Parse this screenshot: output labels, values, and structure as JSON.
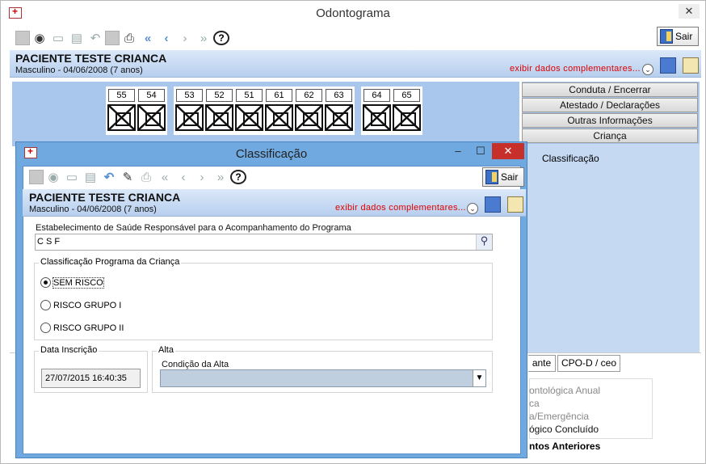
{
  "main_window": {
    "title": "Odontograma",
    "close_glyph": "✕"
  },
  "toolbar": {
    "sair_label": "Sair"
  },
  "patient": {
    "name": "PACIENTE TESTE CRIANCA",
    "info": "Masculino - 04/06/2008 (7 anos)",
    "exibir": "exibir dados complementares..."
  },
  "teeth": {
    "group1": [
      "55",
      "54"
    ],
    "group2": [
      "53",
      "52",
      "51",
      "61",
      "62",
      "63"
    ],
    "group3": [
      "64",
      "65"
    ]
  },
  "right_tabs": [
    "Conduta / Encerrar",
    "Atestado / Declarações",
    "Outras Informações",
    "Criança"
  ],
  "right_pane_text": "Classificação",
  "bottom_tabs": [
    "ante",
    "CPO-D / ceo"
  ],
  "lower_list": [
    "ontológica Anual",
    "ca",
    "a/Emergência",
    "ógico Concluído"
  ],
  "lower_bold": "ntos Anteriores",
  "dialog": {
    "title": "Classificação",
    "min": "–",
    "max": "☐",
    "close": "✕",
    "sair_label": "Sair",
    "patient_name": "PACIENTE TESTE CRIANCA",
    "patient_info": "Masculino - 04/06/2008 (7 anos)",
    "exibir": "exibir dados complementares...",
    "estab_label": "Estabelecimento de Saúde Responsável para o Acompanhamento do Programa",
    "estab_value": "C S F",
    "classif_group": "Classificação Programa da Criança",
    "radios": [
      "SEM RISCO",
      "RISCO GRUPO I",
      "RISCO GRUPO II"
    ],
    "selected_radio": "SEM RISCO",
    "data_inscricao_label": "Data Inscrição",
    "data_inscricao_value": "27/07/2015 16:40:35",
    "alta_label": "Alta",
    "condicao_label": "Condição da Alta",
    "condicao_value": ""
  }
}
